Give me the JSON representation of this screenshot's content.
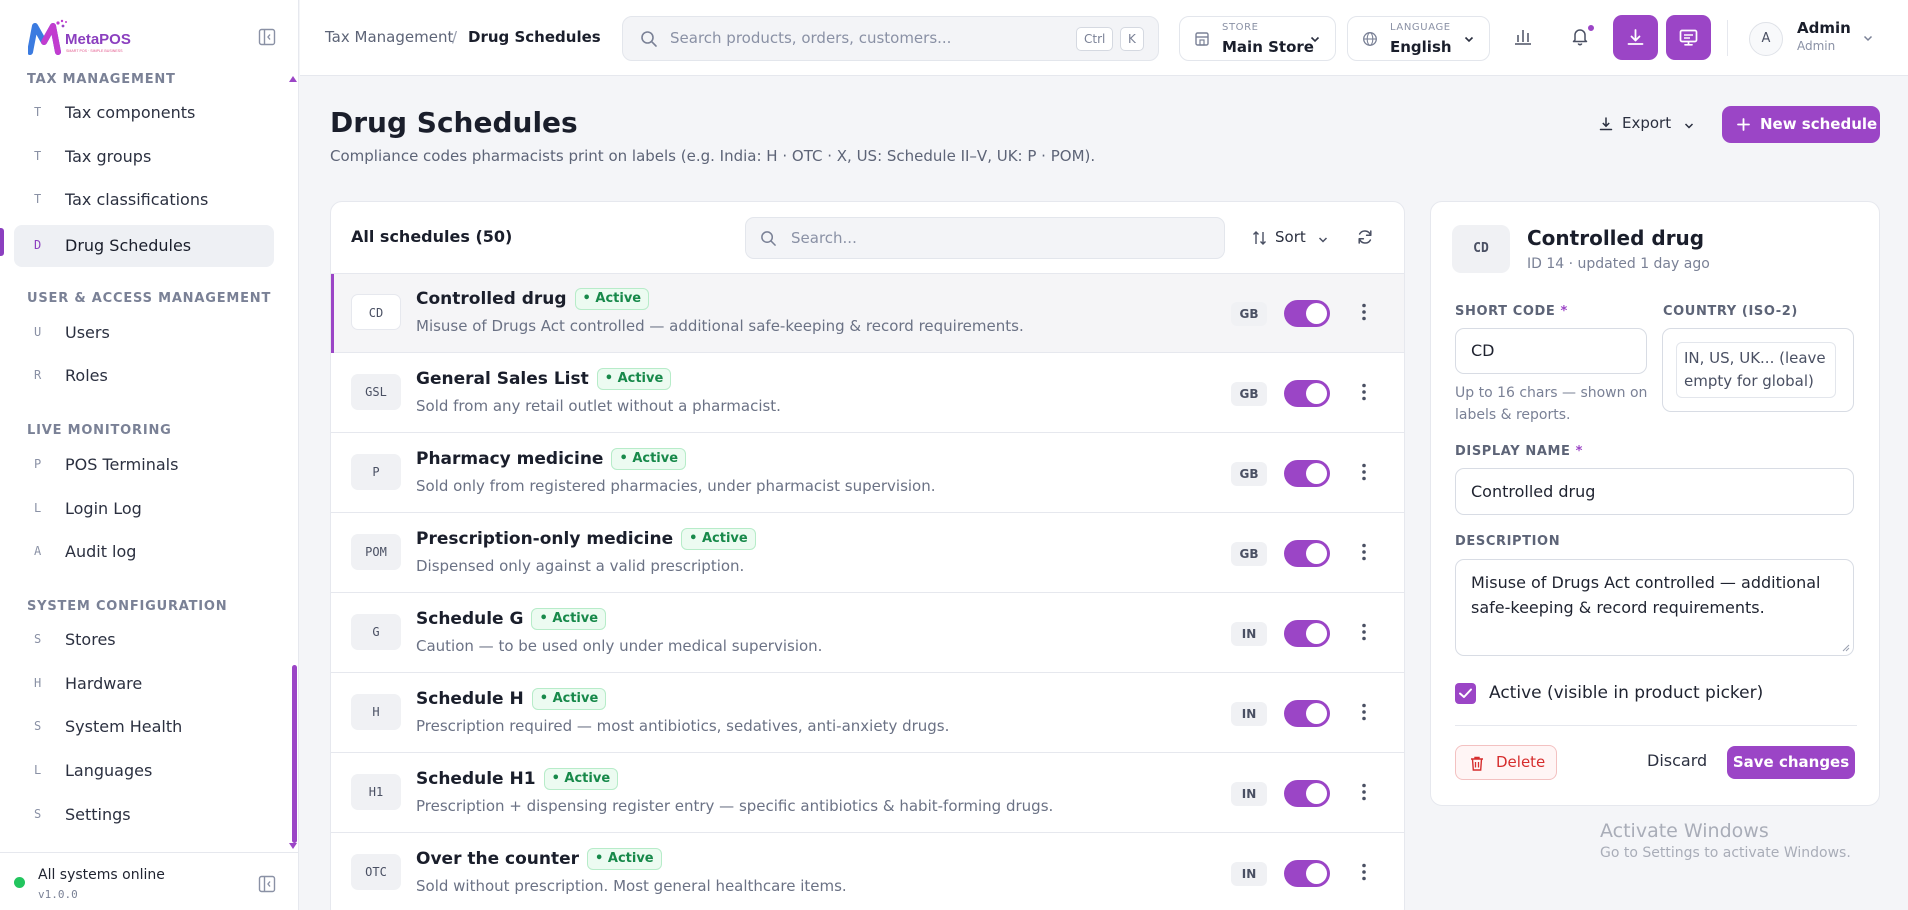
{
  "brand": {
    "name": "MetaPOS",
    "tagline": "SMART POS · SIMPLE BUSINESS",
    "accent": "#9b45c6"
  },
  "sidebar": {
    "sections": [
      {
        "title": "TAX MANAGEMENT",
        "items": [
          {
            "letter": "T",
            "label": "Tax components"
          },
          {
            "letter": "T",
            "label": "Tax groups"
          },
          {
            "letter": "T",
            "label": "Tax classifications"
          },
          {
            "letter": "D",
            "label": "Drug Schedules",
            "active": true
          }
        ]
      },
      {
        "title": "USER & ACCESS MANAGEMENT",
        "items": [
          {
            "letter": "U",
            "label": "Users"
          },
          {
            "letter": "R",
            "label": "Roles"
          }
        ]
      },
      {
        "title": "LIVE MONITORING",
        "items": [
          {
            "letter": "P",
            "label": "POS Terminals"
          },
          {
            "letter": "L",
            "label": "Login Log"
          },
          {
            "letter": "A",
            "label": "Audit log"
          }
        ]
      },
      {
        "title": "SYSTEM CONFIGURATION",
        "items": [
          {
            "letter": "S",
            "label": "Stores"
          },
          {
            "letter": "H",
            "label": "Hardware"
          },
          {
            "letter": "S",
            "label": "System Health"
          },
          {
            "letter": "L",
            "label": "Languages"
          },
          {
            "letter": "S",
            "label": "Settings"
          }
        ]
      }
    ],
    "footer": {
      "status": "All systems online",
      "version": "v1.0.0"
    }
  },
  "topbar": {
    "breadcrumb": [
      "Tax Management",
      "Drug Schedules"
    ],
    "breadcrumb_sep": "/",
    "search": {
      "placeholder": "Search products, orders, customers...",
      "kbd": [
        "Ctrl",
        "K"
      ]
    },
    "store": {
      "caption": "STORE",
      "value": "Main Store"
    },
    "language": {
      "caption": "LANGUAGE",
      "value": "English"
    },
    "user": {
      "initial": "A",
      "name": "Admin",
      "role": "Admin"
    }
  },
  "page": {
    "title": "Drug Schedules",
    "subtitle": "Compliance codes pharmacists print on labels (e.g. India: H · OTC · X, US: Schedule II–V, UK: P · POM).",
    "export_label": "Export",
    "new_label": "New schedule"
  },
  "list": {
    "title": "All schedules (50)",
    "search_placeholder": "Search...",
    "sort_label": "Sort",
    "rows": [
      {
        "code": "CD",
        "name": "Controlled drug",
        "status": "Active",
        "desc": "Misuse of Drugs Act controlled — additional safe-keeping & record requirements.",
        "country": "GB",
        "enabled": true,
        "selected": true
      },
      {
        "code": "GSL",
        "name": "General Sales List",
        "status": "Active",
        "desc": "Sold from any retail outlet without a pharmacist.",
        "country": "GB",
        "enabled": true
      },
      {
        "code": "P",
        "name": "Pharmacy medicine",
        "status": "Active",
        "desc": "Sold only from registered pharmacies, under pharmacist supervision.",
        "country": "GB",
        "enabled": true
      },
      {
        "code": "POM",
        "name": "Prescription-only medicine",
        "status": "Active",
        "desc": "Dispensed only against a valid prescription.",
        "country": "GB",
        "enabled": true
      },
      {
        "code": "G",
        "name": "Schedule G",
        "status": "Active",
        "desc": "Caution — to be used only under medical supervision.",
        "country": "IN",
        "enabled": true
      },
      {
        "code": "H",
        "name": "Schedule H",
        "status": "Active",
        "desc": "Prescription required — most antibiotics, sedatives, anti-anxiety drugs.",
        "country": "IN",
        "enabled": true
      },
      {
        "code": "H1",
        "name": "Schedule H1",
        "status": "Active",
        "desc": "Prescription + dispensing register entry — specific antibiotics & habit-forming drugs.",
        "country": "IN",
        "enabled": true
      },
      {
        "code": "OTC",
        "name": "Over the counter",
        "status": "Active",
        "desc": "Sold without prescription. Most general healthcare items.",
        "country": "IN",
        "enabled": true
      }
    ]
  },
  "detail": {
    "code": "CD",
    "title": "Controlled drug",
    "meta": "ID 14 · updated 1 day ago",
    "short_code_label": "SHORT CODE",
    "short_code_value": "CD",
    "short_code_hint": "Up to 16 chars — shown on labels & reports.",
    "country_label": "COUNTRY (ISO-2)",
    "country_placeholder": "IN, US, UK... (leave empty for global)",
    "display_name_label": "DISPLAY NAME",
    "display_name_value": "Controlled drug",
    "description_label": "DESCRIPTION",
    "description_value": "Misuse of Drugs Act controlled — additional safe-keeping & record requirements.",
    "required_mark": "*",
    "active_label": "Active (visible in product picker)",
    "active_checked": true,
    "delete_label": "Delete",
    "discard_label": "Discard",
    "save_label": "Save changes"
  },
  "watermark": {
    "line1": "Activate Windows",
    "line2": "Go to Settings to activate Windows."
  }
}
